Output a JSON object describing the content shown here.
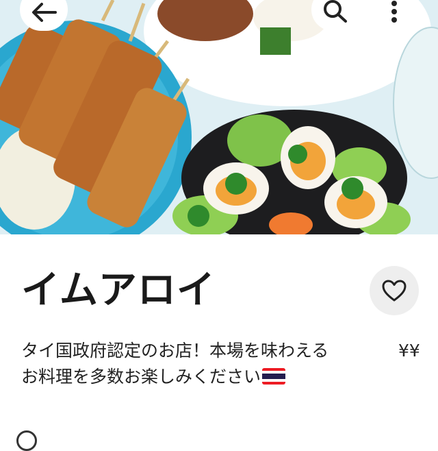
{
  "restaurant": {
    "name": "イムアロイ",
    "description_line1": "タイ国政府認定のお店！本場を味わえる",
    "description_line2": "お料理を多数お楽しみください",
    "price_level": "¥¥"
  },
  "header": {
    "back_icon": "arrow-left-icon",
    "search_icon": "search-icon",
    "more_icon": "more-vertical-icon"
  },
  "actions": {
    "favorite_icon": "heart-outline-icon"
  },
  "hero": {
    "image_description_icon": "food-photo",
    "flag_icon": "thailand-flag-icon"
  },
  "colors": {
    "text": "#1a1a1a",
    "button_bg": "#ffffff",
    "favorite_bg": "#eeeeee",
    "plate_blue": "#2aa7cf"
  }
}
